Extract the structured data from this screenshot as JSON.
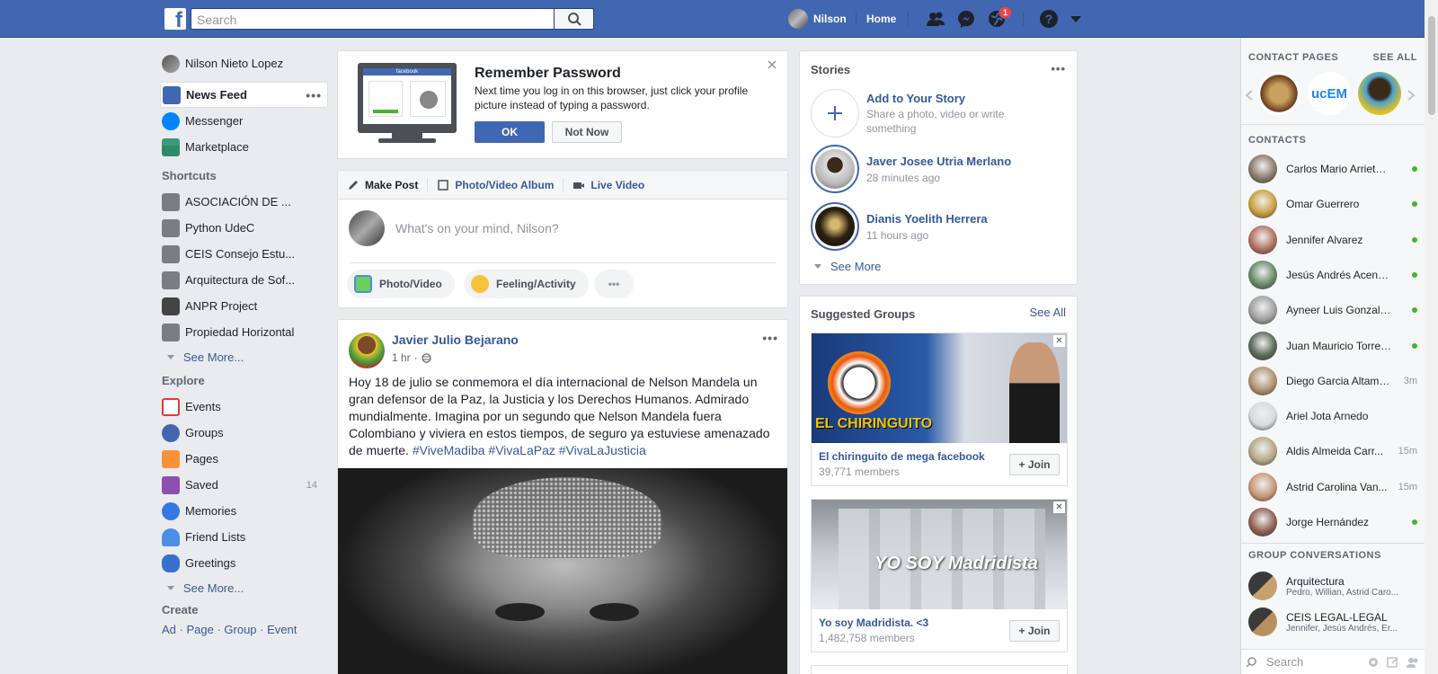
{
  "topbar": {
    "logo": "f",
    "search_placeholder": "Search",
    "user_name": "Nilson",
    "home_label": "Home",
    "notification_count": "1",
    "help_label": "?"
  },
  "leftnav": {
    "profile_name": "Nilson Nieto Lopez",
    "main_items": [
      {
        "label": "News Feed",
        "icon": "news-feed-icon"
      },
      {
        "label": "Messenger",
        "icon": "messenger-icon"
      },
      {
        "label": "Marketplace",
        "icon": "marketplace-icon"
      }
    ],
    "shortcuts_heading": "Shortcuts",
    "shortcuts": [
      {
        "label": "ASOCIACIÓN DE ...",
        "icon": "group-icon"
      },
      {
        "label": "Python UdeC",
        "icon": "group-icon"
      },
      {
        "label": "CEIS Consejo Estu...",
        "icon": "group-icon"
      },
      {
        "label": "Arquitectura de Sof...",
        "icon": "group-icon"
      },
      {
        "label": "ANPR Project",
        "icon": "camera-icon"
      },
      {
        "label": "Propiedad Horizontal",
        "icon": "group-icon"
      }
    ],
    "see_more": "See More...",
    "explore_heading": "Explore",
    "explore": [
      {
        "label": "Events",
        "icon": "calendar-icon",
        "count": ""
      },
      {
        "label": "Groups",
        "icon": "groups-icon",
        "count": ""
      },
      {
        "label": "Pages",
        "icon": "flag-icon",
        "count": ""
      },
      {
        "label": "Saved",
        "icon": "bookmark-icon",
        "count": "14"
      },
      {
        "label": "Memories",
        "icon": "clock-icon",
        "count": ""
      },
      {
        "label": "Friend Lists",
        "icon": "friend-list-icon",
        "count": ""
      },
      {
        "label": "Greetings",
        "icon": "wave-icon",
        "count": ""
      }
    ],
    "see_more_2": "See More...",
    "create_heading": "Create",
    "create_links": [
      "Ad",
      "Page",
      "Group",
      "Event"
    ]
  },
  "remember": {
    "title": "Remember Password",
    "body": "Next time you log in on this browser, just click your profile picture instead of typing a password.",
    "ok": "OK",
    "not_now": "Not Now",
    "monitor_label": "facebook"
  },
  "composer": {
    "tabs": [
      "Make Post",
      "Photo/Video Album",
      "Live Video"
    ],
    "placeholder": "What's on your mind, Nilson?",
    "actions": [
      "Photo/Video",
      "Feeling/Activity"
    ],
    "more": "•••"
  },
  "post": {
    "author": "Javier Julio Bejarano",
    "time": "1 hr",
    "text": "Hoy 18 de julio se conmemora el día internacional de Nelson Mandela un gran defensor de la Paz, la Justicia y los Derechos Humanos. Admirado mundialmente. Imagina por un segundo que Nelson Mandela fuera Colombiano y viviera en estos tiempos, de seguro ya estuviese amenazado de muerte.",
    "hashtags": "#ViveMadiba #VivaLaPaz #VivaLaJusticia",
    "more": "•••"
  },
  "stories": {
    "heading": "Stories",
    "add_title": "Add to Your Story",
    "add_sub": "Share a photo, video or write something",
    "items": [
      {
        "name": "Javer Josee Utria Merlano",
        "time": "28 minutes ago"
      },
      {
        "name": "Dianis Yoelith Herrera",
        "time": "11 hours ago"
      }
    ],
    "see_more": "See More",
    "more": "•••"
  },
  "suggested": {
    "heading": "Suggested Groups",
    "see_all": "See All",
    "groups": [
      {
        "name": "El chiringuito de mega facebook",
        "members": "39,771 members",
        "join": "Join",
        "banner_text": "EL CHIRINGUITO"
      },
      {
        "name": "Yo soy Madridista. <3",
        "members": "1,482,758 members",
        "join": "Join",
        "banner_text": "YO SOY Madridista"
      }
    ]
  },
  "rightbar": {
    "contact_pages_heading": "CONTACT PAGES",
    "see_all": "SEE ALL",
    "contact_pages_logo": "ucEM",
    "contacts_heading": "CONTACTS",
    "contacts": [
      {
        "name": "Carlos Mario Arrieta ...",
        "status": "online"
      },
      {
        "name": "Omar Guerrero",
        "status": "online"
      },
      {
        "name": "Jennifer Alvarez",
        "status": "online"
      },
      {
        "name": "Jesús Andrés Acendr...",
        "status": "online"
      },
      {
        "name": "Ayneer Luis Gonzale...",
        "status": "online"
      },
      {
        "name": "Juan Mauricio Torres ...",
        "status": "online"
      },
      {
        "name": "Diego Garcia Altamir...",
        "status": "3m"
      },
      {
        "name": "Ariel Jota Arnedo",
        "status": ""
      },
      {
        "name": "Aldis Almeida Carr...",
        "status": "15m"
      },
      {
        "name": "Astrid Carolina Van...",
        "status": "15m"
      },
      {
        "name": "Jorge Hernández",
        "status": "online"
      }
    ],
    "group_conv_heading": "GROUP CONVERSATIONS",
    "group_convs": [
      {
        "name": "Arquitectura",
        "members": "Pedro, Willian, Astrid Caro..."
      },
      {
        "name": "CEIS LEGAL-LEGAL",
        "members": "Jennifer, Jesús Andrés, Er..."
      }
    ],
    "search_placeholder": "Search"
  },
  "colors": {
    "brand_blue": "#4267b2",
    "link_blue": "#385898",
    "online_green": "#42b72a",
    "background": "#e9ebee"
  }
}
